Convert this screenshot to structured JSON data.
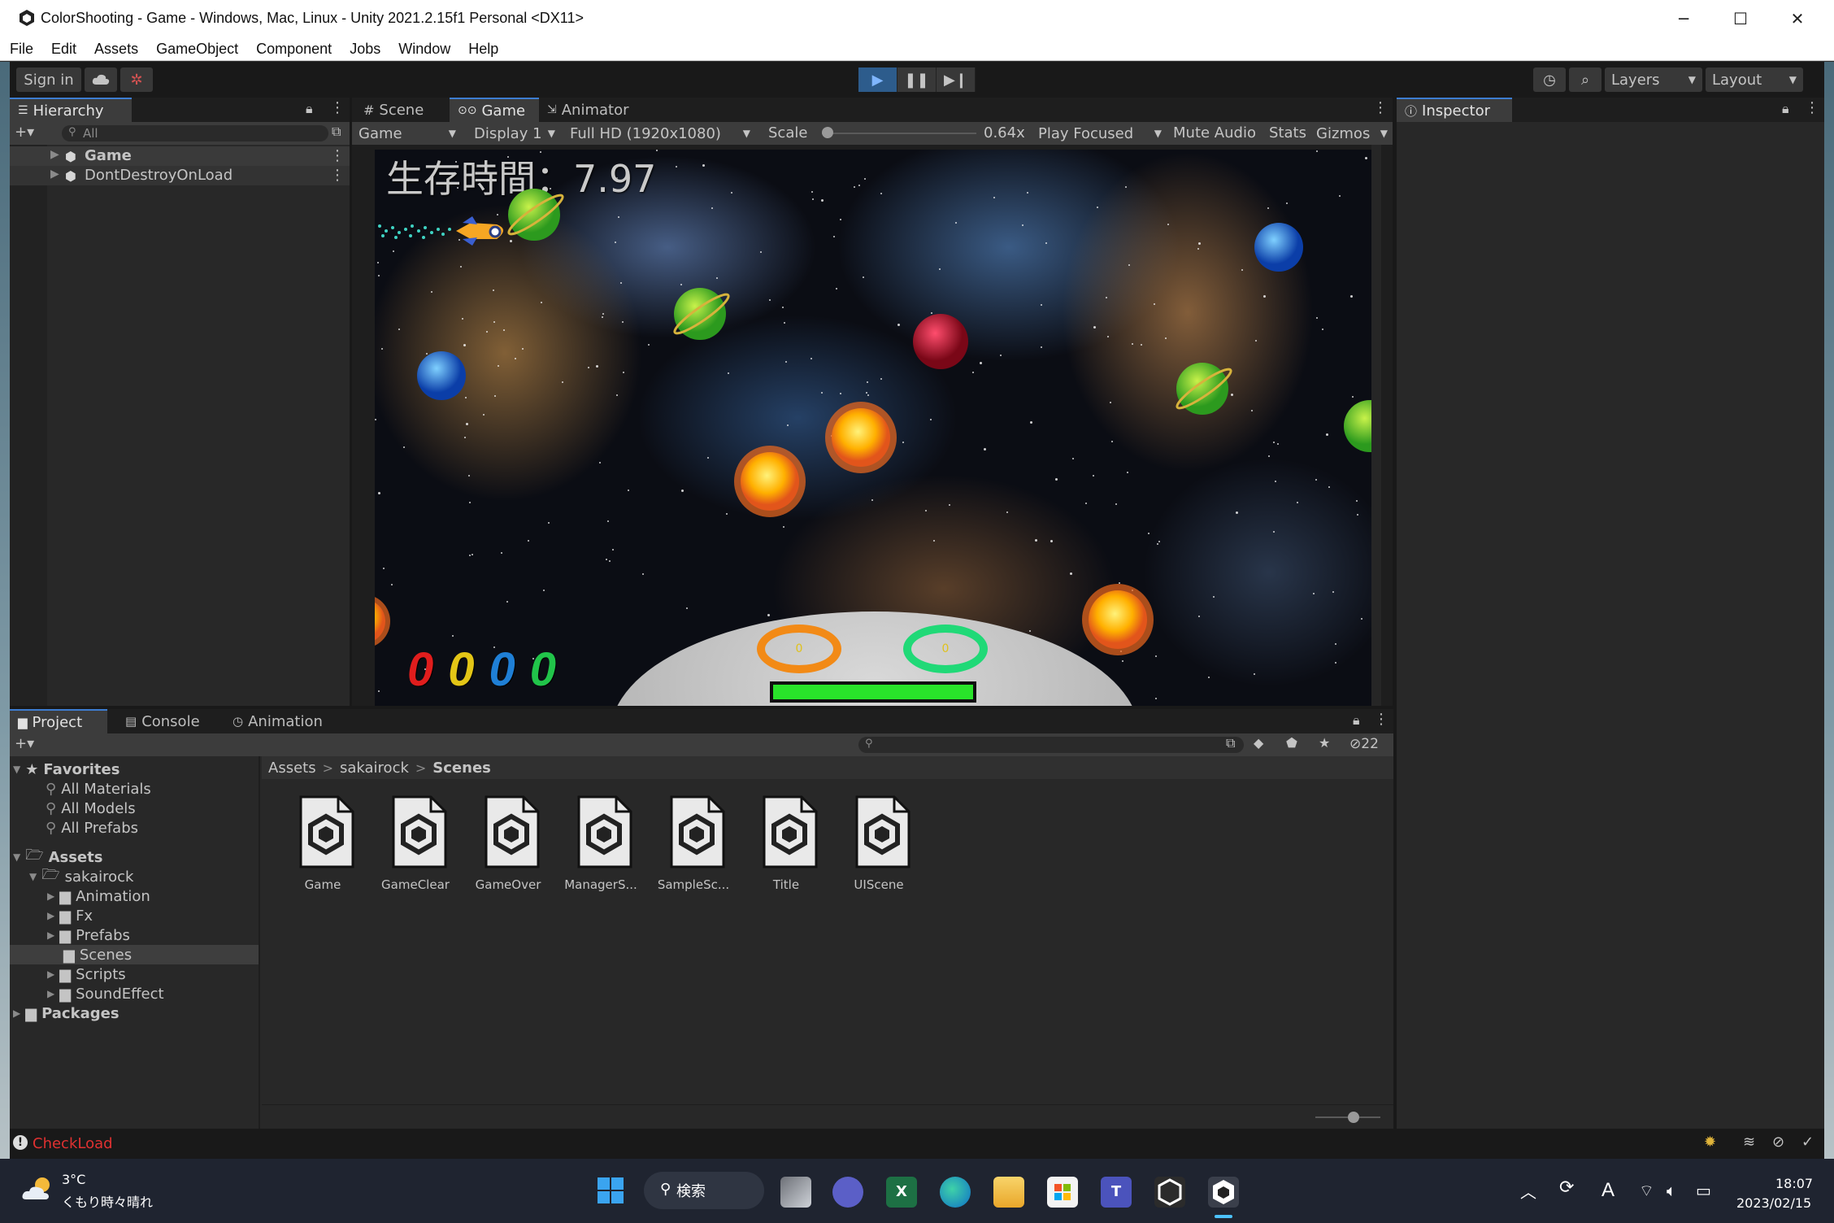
{
  "window": {
    "title": "ColorShooting - Game - Windows, Mac, Linux - Unity 2021.2.15f1 Personal <DX11>",
    "minimize": "─",
    "maximize": "☐",
    "close": "✕"
  },
  "menu": [
    "File",
    "Edit",
    "Assets",
    "GameObject",
    "Component",
    "Jobs",
    "Window",
    "Help"
  ],
  "toolbar": {
    "sign_in": "Sign in",
    "layers": "Layers",
    "layout": "Layout",
    "play_state": "playing"
  },
  "hierarchy": {
    "tab": "Hierarchy",
    "search_placeholder": "All",
    "items": [
      "Game",
      "DontDestroyOnLoad"
    ]
  },
  "game_view": {
    "tabs": [
      "Scene",
      "Game",
      "Animator"
    ],
    "active_tab": "Game",
    "view_mode": "Game",
    "display": "Display 1",
    "resolution": "Full HD (1920x1080)",
    "scale_label": "Scale",
    "scale_value": "0.64x",
    "scale_level": 0.0,
    "play_focused": "Play Focused",
    "mute_audio": "Mute Audio",
    "stats": "Stats",
    "gizmos": "Gizmos"
  },
  "hud": {
    "survival_time": "生存時間：7.97",
    "scores": [
      {
        "value": "0",
        "color": "#e01d1d"
      },
      {
        "value": "0",
        "color": "#e3c516"
      },
      {
        "value": "0",
        "color": "#1f7fd6"
      },
      {
        "value": "0",
        "color": "#21c44a"
      }
    ],
    "ring_left_value": "0",
    "ring_right_value": "0",
    "ring_left_color": "#f28a16",
    "ring_right_color": "#20d977",
    "health_level": 1.0
  },
  "inspector": {
    "tab": "Inspector"
  },
  "project": {
    "tabs": [
      "Project",
      "Console",
      "Animation"
    ],
    "hidden_count": "22",
    "favorites_label": "Favorites",
    "favorites": [
      "All Materials",
      "All Models",
      "All Prefabs"
    ],
    "assets_label": "Assets",
    "sakairock": "sakairock",
    "folders": [
      "Animation",
      "Fx",
      "Prefabs",
      "Scenes",
      "Scripts",
      "SoundEffect"
    ],
    "selected_folder": "Scenes",
    "packages": "Packages",
    "breadcrumb": [
      "Assets",
      "sakairock",
      "Scenes"
    ],
    "breadcrumb_sep": ">",
    "files": [
      "Game",
      "GameClear",
      "GameOver",
      "ManagerS...",
      "SampleSc...",
      "Title",
      "UIScene"
    ]
  },
  "status": {
    "message": "CheckLoad",
    "message_color": "#e03131"
  },
  "taskbar": {
    "weather_temp": "3°C",
    "weather_desc": "くもり時々晴れ",
    "search": "検索",
    "ime": "A",
    "time": "18:07",
    "date": "2023/02/15"
  }
}
